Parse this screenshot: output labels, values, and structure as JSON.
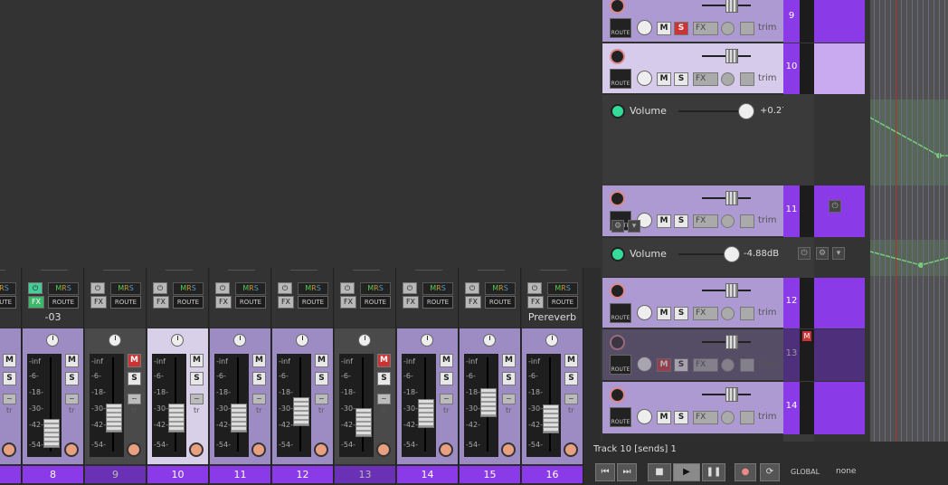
{
  "mixer": {
    "scale_labels": [
      "-inf",
      "-6-",
      "-18-",
      "-30-",
      "-42-",
      "-54-"
    ],
    "fx_label": "FX",
    "route_label": "ROUTE",
    "m_label": "M",
    "s_label": "S",
    "tr_label": "tr",
    "strips": [
      {
        "num": "",
        "name": ""
      },
      {
        "num": "8",
        "name": "-03"
      },
      {
        "num": "9",
        "name": ""
      },
      {
        "num": "10",
        "name": ""
      },
      {
        "num": "11",
        "name": ""
      },
      {
        "num": "12",
        "name": ""
      },
      {
        "num": "13",
        "name": ""
      },
      {
        "num": "14",
        "name": ""
      },
      {
        "num": "15",
        "name": ""
      },
      {
        "num": "16",
        "name": "Prereverb"
      }
    ],
    "mrs_letters": {
      "m": "M",
      "r": "R",
      "s": "S"
    }
  },
  "tcp": {
    "m_label": "M",
    "s_label": "S",
    "fx_label": "FX",
    "trim_label": "trim",
    "route_label": "ROUTE",
    "tracks": [
      {
        "num": "9"
      },
      {
        "num": "10"
      },
      {
        "num": "11"
      },
      {
        "num": "12"
      },
      {
        "num": "13"
      },
      {
        "num": "14"
      }
    ],
    "lanes": [
      {
        "label": "Volume",
        "value": "+0.27dB"
      },
      {
        "label": "Volume",
        "value": "-4.88dB"
      }
    ],
    "rec_badge": "M"
  },
  "transport": {
    "status": "Track 10 [sends] 1",
    "global_label": "GLOBAL",
    "none_label": "none",
    "buttons": {
      "prev": "⏮",
      "next": "⏭",
      "stop": "■",
      "play": "▶",
      "pause": "❚❚",
      "record": "●",
      "loop": "⟳"
    }
  },
  "colors": {
    "track_purple": "#8a3ae6",
    "strip_lavender": "#9d8bc4",
    "fx_on_green": "#3db86a",
    "mute_red": "#cc3333"
  }
}
